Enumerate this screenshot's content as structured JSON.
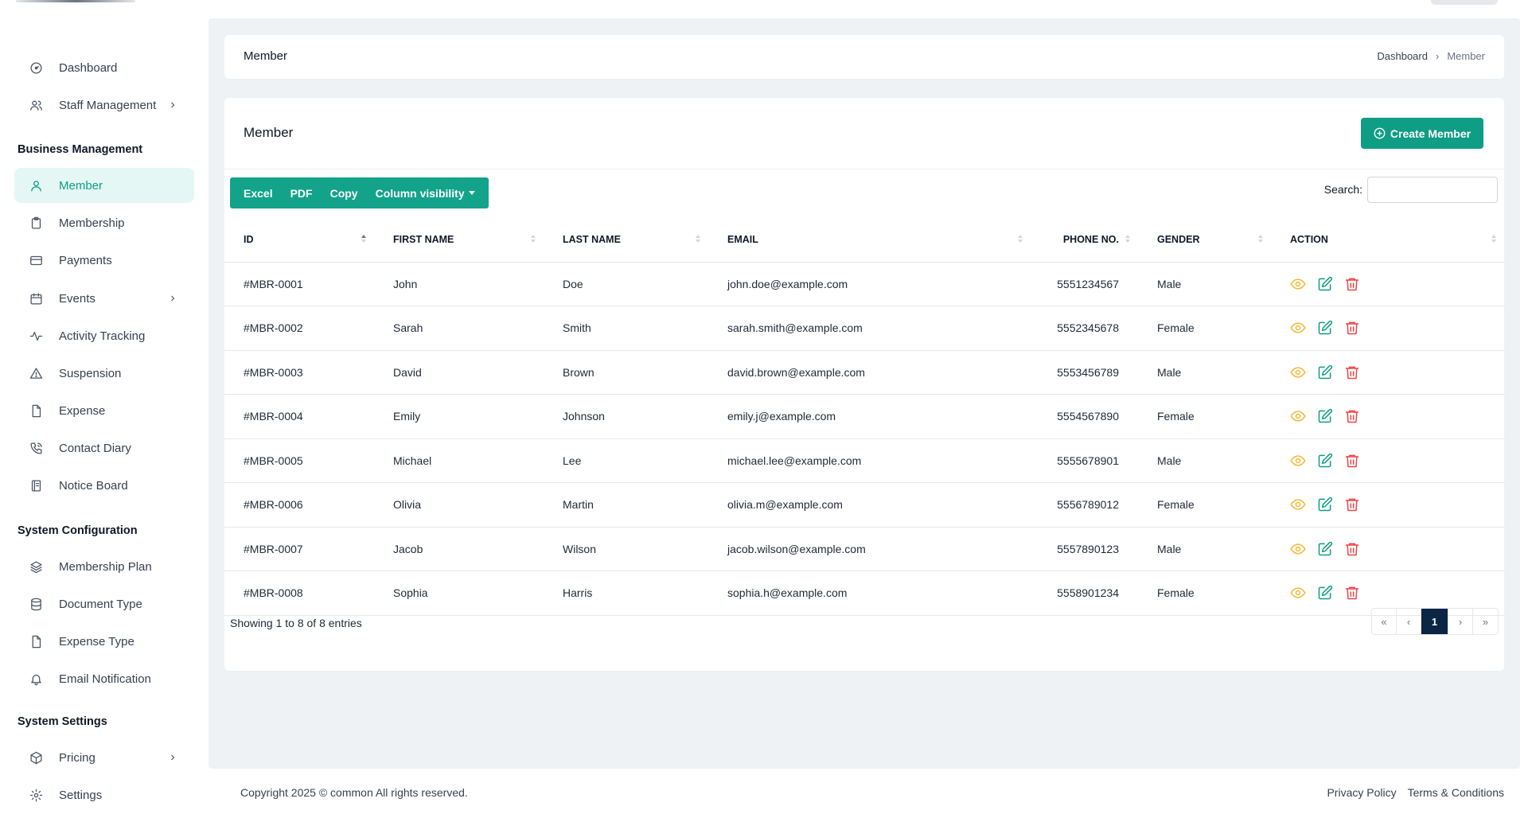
{
  "sidebar": {
    "top_items": [
      {
        "label": "Dashboard",
        "icon": "dashboard-gauge-icon",
        "chevron": false
      },
      {
        "label": "Staff Management",
        "icon": "users-icon",
        "chevron": true
      }
    ],
    "sections": [
      {
        "title": "Business Management",
        "items": [
          {
            "label": "Member",
            "icon": "user-icon",
            "active": true,
            "chevron": false
          },
          {
            "label": "Membership",
            "icon": "clipboard-icon",
            "chevron": false
          },
          {
            "label": "Payments",
            "icon": "credit-card-icon",
            "chevron": false
          },
          {
            "label": "Events",
            "icon": "calendar-icon",
            "chevron": true
          },
          {
            "label": "Activity Tracking",
            "icon": "activity-pulse-icon",
            "chevron": false
          },
          {
            "label": "Suspension",
            "icon": "alert-triangle-icon",
            "chevron": false
          },
          {
            "label": "Expense",
            "icon": "file-icon",
            "chevron": false
          },
          {
            "label": "Contact Diary",
            "icon": "phone-icon",
            "chevron": false
          },
          {
            "label": "Notice Board",
            "icon": "notebook-icon",
            "chevron": false
          }
        ]
      },
      {
        "title": "System Configuration",
        "items": [
          {
            "label": "Membership Plan",
            "icon": "layers-icon",
            "chevron": false
          },
          {
            "label": "Document Type",
            "icon": "database-icon",
            "chevron": false
          },
          {
            "label": "Expense Type",
            "icon": "file-icon",
            "chevron": false
          },
          {
            "label": "Email Notification",
            "icon": "bell-icon",
            "chevron": false
          }
        ]
      },
      {
        "title": "System Settings",
        "items": [
          {
            "label": "Pricing",
            "icon": "package-icon",
            "chevron": true
          },
          {
            "label": "Settings",
            "icon": "gear-icon",
            "chevron": false
          }
        ]
      }
    ]
  },
  "breadcrumb": {
    "title": "Member",
    "items": [
      "Dashboard",
      "Member"
    ],
    "separator": "›"
  },
  "card": {
    "title": "Member",
    "create_label": "Create Member"
  },
  "export": {
    "buttons": [
      "Excel",
      "PDF",
      "Copy"
    ],
    "column_visibility": "Column visibility"
  },
  "search": {
    "label": "Search:",
    "value": ""
  },
  "table": {
    "columns": [
      "ID",
      "FIRST NAME",
      "LAST NAME",
      "EMAIL",
      "PHONE NO.",
      "GENDER",
      "ACTION"
    ],
    "rows": [
      [
        "#MBR-0001",
        "John",
        "Doe",
        "john.doe@example.com",
        "5551234567",
        "Male"
      ],
      [
        "#MBR-0002",
        "Sarah",
        "Smith",
        "sarah.smith@example.com",
        "5552345678",
        "Female"
      ],
      [
        "#MBR-0003",
        "David",
        "Brown",
        "david.brown@example.com",
        "5553456789",
        "Male"
      ],
      [
        "#MBR-0004",
        "Emily",
        "Johnson",
        "emily.j@example.com",
        "5554567890",
        "Female"
      ],
      [
        "#MBR-0005",
        "Michael",
        "Lee",
        "michael.lee@example.com",
        "5555678901",
        "Male"
      ],
      [
        "#MBR-0006",
        "Olivia",
        "Martin",
        "olivia.m@example.com",
        "5556789012",
        "Female"
      ],
      [
        "#MBR-0007",
        "Jacob",
        "Wilson",
        "jacob.wilson@example.com",
        "5557890123",
        "Male"
      ],
      [
        "#MBR-0008",
        "Sophia",
        "Harris",
        "sophia.h@example.com",
        "5558901234",
        "Female"
      ]
    ]
  },
  "info": "Showing 1 to 8 of 8 entries",
  "pagination": {
    "first": "«",
    "prev": "‹",
    "pages": [
      "1"
    ],
    "current": "1",
    "next": "›",
    "last": "»"
  },
  "footer": {
    "copyright": "Copyright 2025 © common All rights reserved.",
    "links": [
      "Privacy Policy",
      "Terms & Conditions"
    ]
  },
  "colors": {
    "primary": "#0f9d85",
    "active_bg": "#e4f7f4",
    "view": "#f5b731",
    "delete": "#ef4444",
    "page_active": "#0b2545"
  }
}
